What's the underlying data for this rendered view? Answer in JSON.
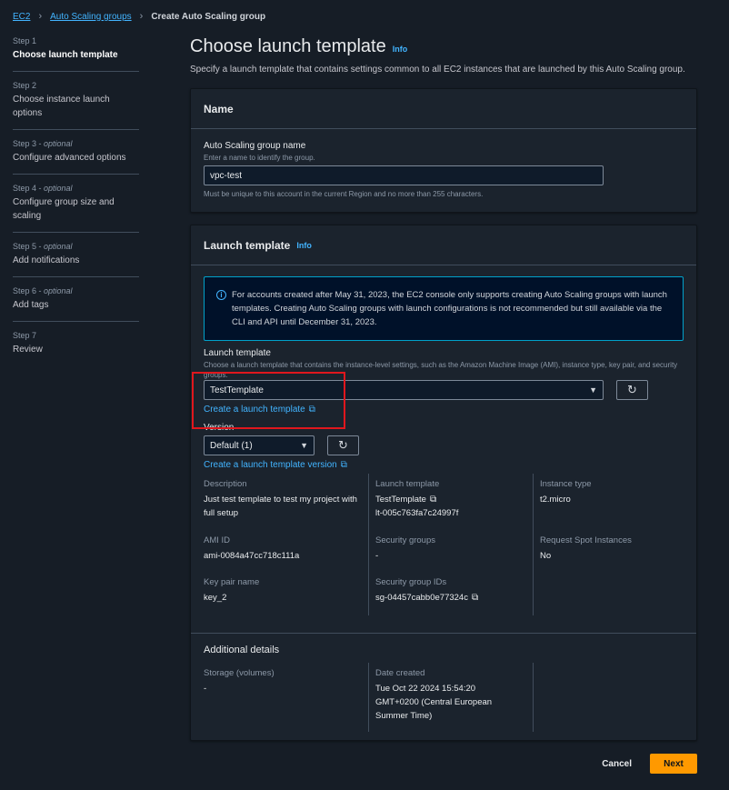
{
  "breadcrumb": {
    "ec2": "EC2",
    "asg": "Auto Scaling groups",
    "current": "Create Auto Scaling group"
  },
  "steps": [
    {
      "num": "Step 1",
      "optional": "",
      "title": "Choose launch template"
    },
    {
      "num": "Step 2",
      "optional": "",
      "title": "Choose instance launch options"
    },
    {
      "num": "Step 3",
      "optional": "optional",
      "title": "Configure advanced options"
    },
    {
      "num": "Step 4",
      "optional": "optional",
      "title": "Configure group size and scaling"
    },
    {
      "num": "Step 5",
      "optional": "optional",
      "title": "Add notifications"
    },
    {
      "num": "Step 6",
      "optional": "optional",
      "title": "Add tags"
    },
    {
      "num": "Step 7",
      "optional": "",
      "title": "Review"
    }
  ],
  "page": {
    "title": "Choose launch template",
    "info": "Info",
    "description": "Specify a launch template that contains settings common to all EC2 instances that are launched by this Auto Scaling group."
  },
  "name_panel": {
    "heading": "Name",
    "label": "Auto Scaling group name",
    "hint": "Enter a name to identify the group.",
    "value": "vpc-test",
    "constraint": "Must be unique to this account in the current Region and no more than 255 characters."
  },
  "lt_panel": {
    "heading": "Launch template",
    "info": "Info",
    "alert": "For accounts created after May 31, 2023, the EC2 console only supports creating Auto Scaling groups with launch templates. Creating Auto Scaling groups with launch configurations is not recommended but still available via the CLI and API until December 31, 2023.",
    "template_label": "Launch template",
    "template_hint": "Choose a launch template that contains the instance-level settings, such as the Amazon Machine Image (AMI), instance type, key pair, and security groups.",
    "template_value": "TestTemplate",
    "create_template_link": "Create a launch template",
    "version_label": "Version",
    "version_value": "Default (1)",
    "create_version_link": "Create a launch template version",
    "details": {
      "description_k": "Description",
      "description_v": "Just test template to test my project with full setup",
      "lt_k": "Launch template",
      "lt_link": "TestTemplate",
      "lt_id": "lt-005c763fa7c24997f",
      "type_k": "Instance type",
      "type_v": "t2.micro",
      "ami_k": "AMI ID",
      "ami_v": "ami-0084a47cc718c111a",
      "sg_k": "Security groups",
      "sg_v": "-",
      "spot_k": "Request Spot Instances",
      "spot_v": "No",
      "key_k": "Key pair name",
      "key_v": "key_2",
      "sgid_k": "Security group IDs",
      "sgid_link": "sg-04457cabb0e77324c"
    },
    "additional": {
      "heading": "Additional details",
      "storage_k": "Storage (volumes)",
      "storage_v": "-",
      "date_k": "Date created",
      "date_v": "Tue Oct 22 2024 15:54:20 GMT+0200 (Central European Summer Time)"
    }
  },
  "footer": {
    "cancel": "Cancel",
    "next": "Next"
  },
  "colors": {
    "accent": "#ff9900",
    "link": "#42b4ff",
    "highlight": "#e0171d"
  }
}
